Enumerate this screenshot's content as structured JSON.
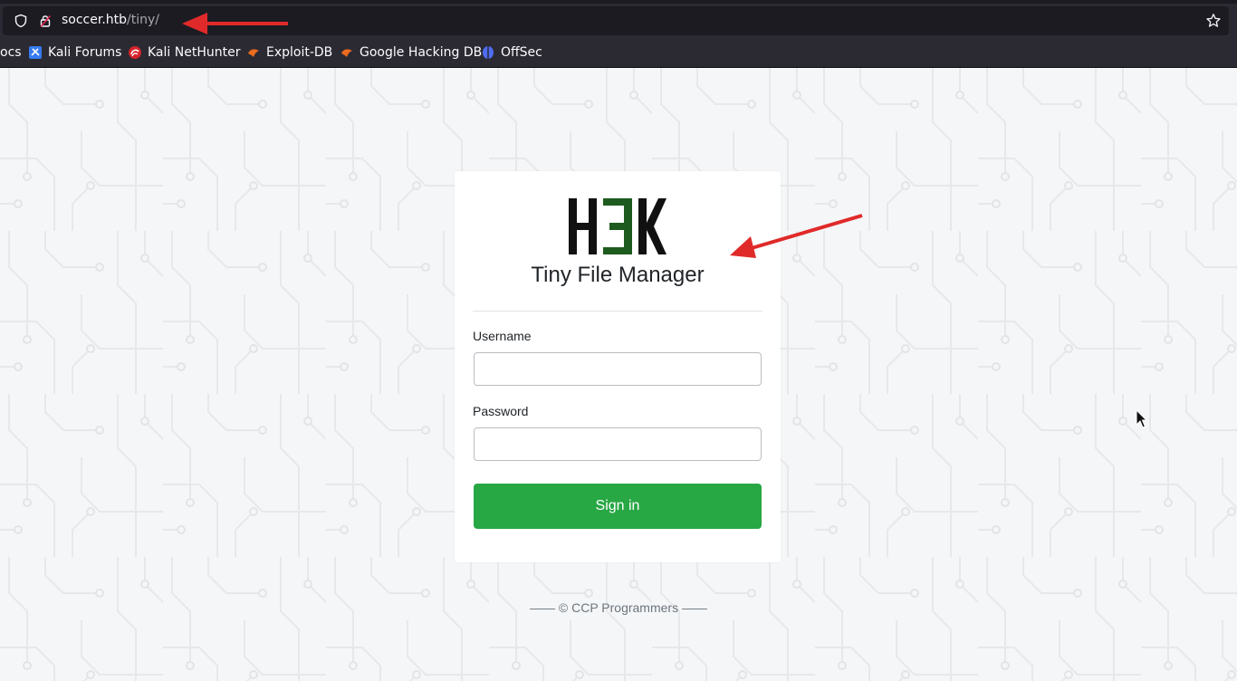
{
  "browser": {
    "url_host": "soccer.htb",
    "url_path": "/tiny/",
    "bookmarks": [
      {
        "label": "ocs",
        "icon": "partial-icon"
      },
      {
        "label": "Kali Forums",
        "icon": "kali-forums-icon"
      },
      {
        "label": "Kali NetHunter",
        "icon": "kali-nethunter-icon"
      },
      {
        "label": "Exploit-DB",
        "icon": "exploit-db-icon"
      },
      {
        "label": "Google Hacking DB",
        "icon": "ghdb-icon"
      },
      {
        "label": "OffSec",
        "icon": "offsec-icon"
      }
    ]
  },
  "login": {
    "logo_text": "H3K",
    "title": "Tiny File Manager",
    "username_label": "Username",
    "username_value": "",
    "password_label": "Password",
    "password_value": "",
    "signin_label": "Sign in"
  },
  "footer": {
    "text": "—— © CCP Programmers ——"
  },
  "colors": {
    "chrome_bg": "#2b2a33",
    "urlbar_bg": "#1c1b22",
    "signin_green": "#28a745",
    "annotation_red": "#e02a2a",
    "logo_black": "#111111",
    "logo_green": "#1e5b1e"
  }
}
